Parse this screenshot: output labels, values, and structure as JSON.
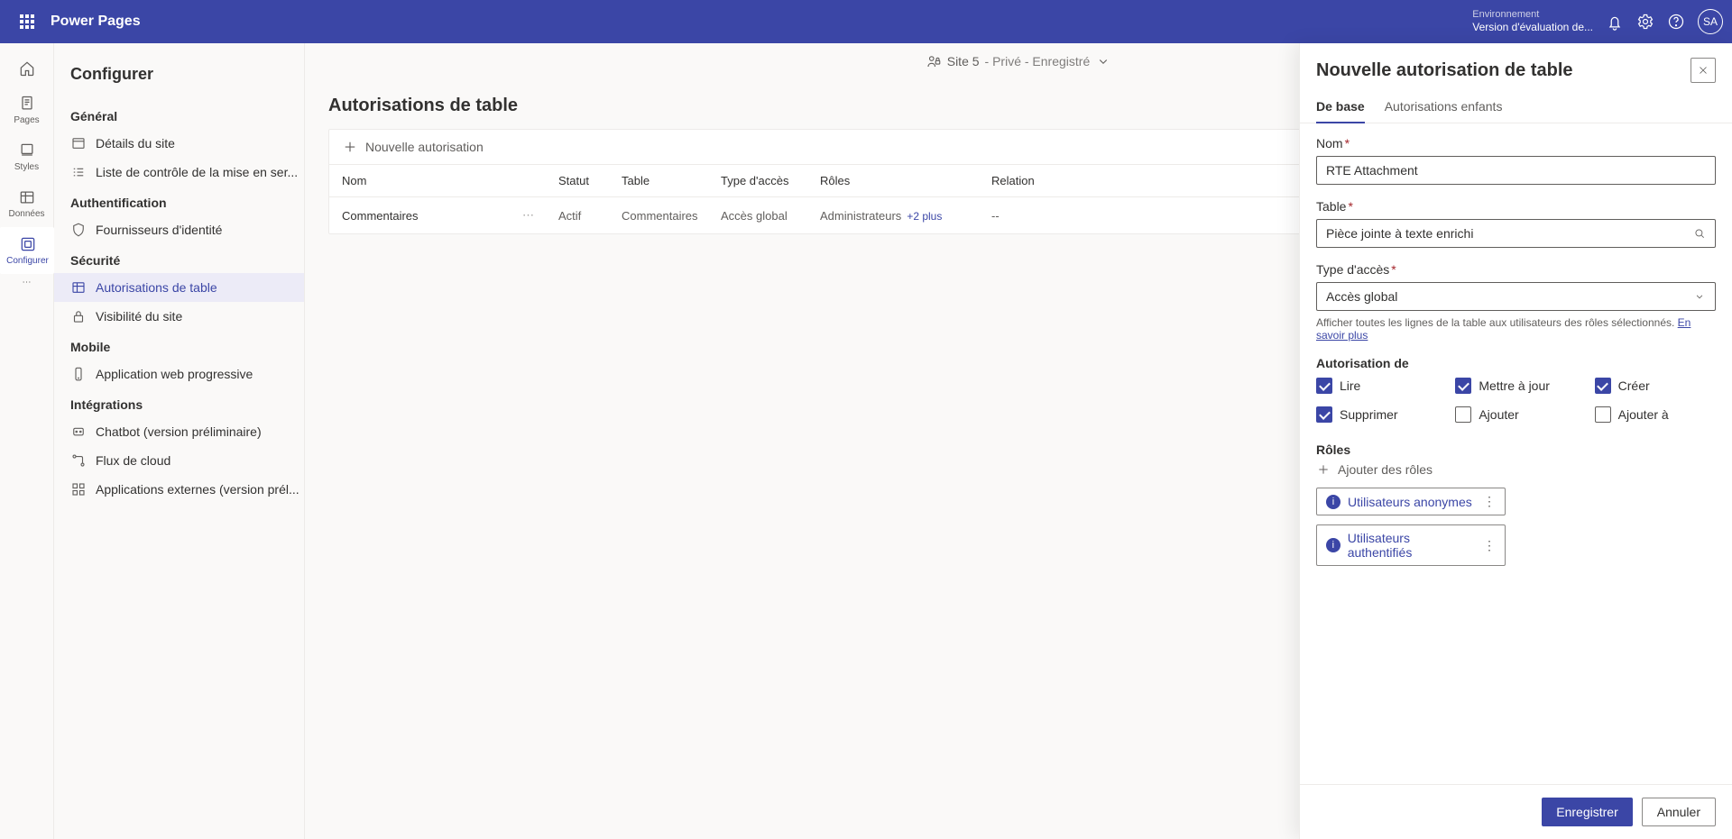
{
  "topbar": {
    "brand": "Power Pages",
    "env_label": "Environnement",
    "env_name": "Version d'évaluation de...",
    "avatar": "SA"
  },
  "rail": [
    {
      "label": ""
    },
    {
      "label": "Pages"
    },
    {
      "label": "Styles"
    },
    {
      "label": "Données"
    },
    {
      "label": "Configurer"
    }
  ],
  "sidebar": {
    "title": "Configurer",
    "groups": [
      {
        "h": "Général",
        "items": [
          "Détails du site",
          "Liste de contrôle de la mise en ser..."
        ]
      },
      {
        "h": "Authentification",
        "items": [
          "Fournisseurs d'identité"
        ]
      },
      {
        "h": "Sécurité",
        "items": [
          "Autorisations de table",
          "Visibilité du site"
        ]
      },
      {
        "h": "Mobile",
        "items": [
          "Application web progressive"
        ]
      },
      {
        "h": "Intégrations",
        "items": [
          "Chatbot (version préliminaire)",
          "Flux de cloud",
          "Applications externes (version prél..."
        ]
      }
    ]
  },
  "crumb": {
    "site": "Site 5",
    "state": "- Privé - Enregistré"
  },
  "page": {
    "title": "Autorisations de table",
    "new_label": "Nouvelle autorisation",
    "cols": {
      "name": "Nom",
      "status": "Statut",
      "table": "Table",
      "access": "Type d'accès",
      "roles": "Rôles",
      "relation": "Relation"
    },
    "rows": [
      {
        "name": "Commentaires",
        "status": "Actif",
        "table": "Commentaires",
        "access": "Accès global",
        "role": "Administrateurs",
        "role_more": "+2 plus",
        "relation": "--"
      }
    ]
  },
  "panel": {
    "title": "Nouvelle autorisation de table",
    "tabs": {
      "base": "De base",
      "children": "Autorisations enfants"
    },
    "labels": {
      "name": "Nom",
      "table": "Table",
      "access": "Type d'accès",
      "perm": "Autorisation de",
      "roles": "Rôles"
    },
    "values": {
      "name": "RTE Attachment",
      "table": "Pièce jointe à texte enrichi",
      "access": "Accès global"
    },
    "help_text": "Afficher toutes les lignes de la table aux utilisateurs des rôles sélectionnés. ",
    "help_link": "En savoir plus",
    "perms": [
      {
        "label": "Lire",
        "checked": true
      },
      {
        "label": "Mettre à jour",
        "checked": true
      },
      {
        "label": "Créer",
        "checked": true
      },
      {
        "label": "Supprimer",
        "checked": true
      },
      {
        "label": "Ajouter",
        "checked": false
      },
      {
        "label": "Ajouter à",
        "checked": false
      }
    ],
    "add_roles": "Ajouter des rôles",
    "role_chips": [
      "Utilisateurs anonymes",
      "Utilisateurs authentifiés"
    ],
    "save": "Enregistrer",
    "cancel": "Annuler"
  }
}
